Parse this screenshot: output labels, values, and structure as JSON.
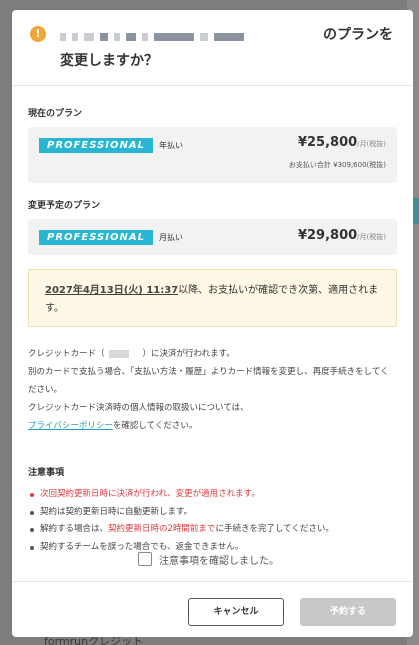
{
  "dialog": {
    "title_tail": "のプランを",
    "title_line2": "変更しますか？"
  },
  "current_plan": {
    "label": "現在のプラン",
    "plan_name": "PROFESSIONAL",
    "billing": "年払い",
    "price": "¥25,800",
    "price_unit": "/月(税抜)",
    "total": "お支払い合計 ¥309,600(税抜)"
  },
  "next_plan": {
    "label": "変更予定のプラン",
    "plan_name": "PROFESSIONAL",
    "billing": "月払い",
    "price": "¥29,800",
    "price_unit": "/月(税抜)"
  },
  "notice": {
    "date": "2027年4月13日(火) 11:37",
    "text": "以降、お支払いが確認でき次第、適用されます。"
  },
  "info": {
    "line1_prefix": "クレジットカード（",
    "line1_suffix": "）に決済が行われます。",
    "line2": "別のカードで支払う場合、「支払い方法・履歴」よりカード情報を変更し、再度手続きをしてください。",
    "line3": "クレジットカード決済時の個人情報の取扱いについては、",
    "privacy_link": "プライバシーポリシー",
    "line4_suffix": "を確認してください。"
  },
  "caution": {
    "title": "注意事項",
    "item1": "次回契約更新日時に決済が行われ、変更が適用されます。",
    "item2": "契約は契約更新日時に自動更新します。",
    "item3_prefix": "解約する場合は、",
    "item3_red": "契約更新日時の2時間前まで",
    "item3_suffix": "に手続きを完了してください。",
    "item4": "契約するチームを誤った場合でも、返金できません。"
  },
  "confirm": {
    "label": "注意事項を確認しました。",
    "checked": false
  },
  "buttons": {
    "cancel": "キャンセル",
    "reserve": "予約する"
  },
  "background": {
    "bottom_text": "formrunクレジット"
  },
  "colors": {
    "badge": "#29b6d3",
    "alert": "#f0a73a",
    "red": "#e0393e",
    "link": "#1d9ec4"
  }
}
